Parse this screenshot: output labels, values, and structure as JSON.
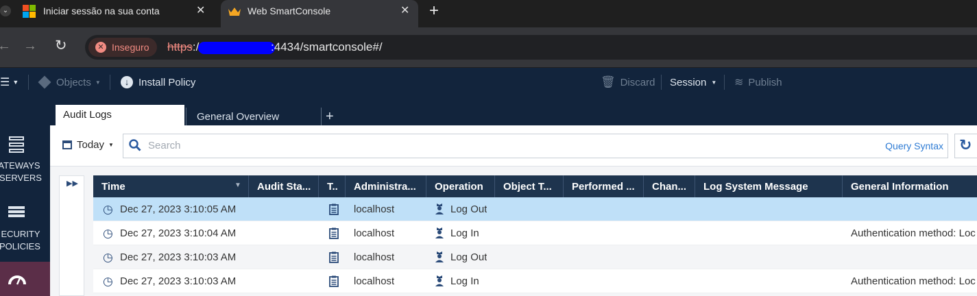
{
  "browser": {
    "tabs": [
      {
        "title": "Iniciar sessão na sua conta",
        "icon": "microsoft-logo-icon",
        "active": false
      },
      {
        "title": "Web SmartConsole",
        "icon": "crown-icon",
        "active": true
      }
    ],
    "new_tab": "+",
    "close": "✕",
    "security_label": "Inseguro",
    "url_scheme": "https",
    "url_rest": "://",
    "url_tail": ":4434/smartconsole#/"
  },
  "appbar": {
    "objects_label": "Objects",
    "install_policy_label": "Install Policy",
    "discard_label": "Discard",
    "session_label": "Session",
    "publish_label": "Publish"
  },
  "sidebar": {
    "gateways_line1": "ATEWAYS",
    "gateways_line2": "SERVERS",
    "security_line1": "ECURITY",
    "security_line2": "POLICIES"
  },
  "logtabs": {
    "audit": "Audit Logs",
    "general": "General Overview",
    "add": "+"
  },
  "filter": {
    "timeframe": "Today",
    "search_placeholder": "Search",
    "query_syntax": "Query Syntax"
  },
  "table": {
    "columns": [
      "Time",
      "Audit Sta...",
      "T..",
      "Administra...",
      "Operation",
      "Object T...",
      "Performed ...",
      "Chan...",
      "Log System Message",
      "General Information"
    ],
    "rows": [
      {
        "time": "Dec 27, 2023 3:10:05 AM",
        "admin": "localhost",
        "operation": "Log Out",
        "info": ""
      },
      {
        "time": "Dec 27, 2023 3:10:04 AM",
        "admin": "localhost",
        "operation": "Log In",
        "info": "Authentication method: Loc"
      },
      {
        "time": "Dec 27, 2023 3:10:03 AM",
        "admin": "localhost",
        "operation": "Log Out",
        "info": ""
      },
      {
        "time": "Dec 27, 2023 3:10:03 AM",
        "admin": "localhost",
        "operation": "Log In",
        "info": "Authentication method: Loc"
      }
    ]
  },
  "colors": {
    "app_bg": "#12243c",
    "header_bg": "#1e344e",
    "selected_row": "#bfe0f8",
    "link": "#2d7bd4",
    "insecure": "#f28b82"
  }
}
